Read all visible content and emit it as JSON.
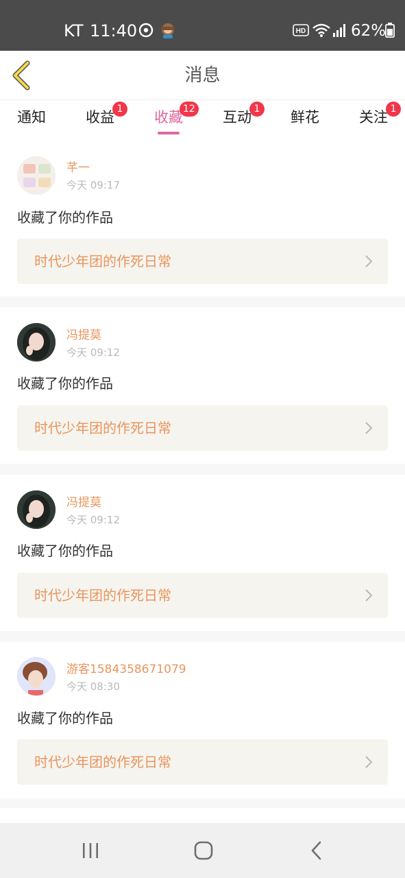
{
  "status_bar": {
    "carrier": "KT",
    "time": "11:40",
    "battery_percent": "62%",
    "icons": [
      "weibo-icon",
      "monkey-emoji-icon",
      "hd-icon",
      "wifi-icon",
      "signal-icon",
      "battery-icon"
    ]
  },
  "header": {
    "title": "消息",
    "back_icon": "chevron-left-icon"
  },
  "tabs": [
    {
      "label": "通知",
      "badge": ""
    },
    {
      "label": "收益",
      "badge": "1"
    },
    {
      "label": "收藏",
      "badge": "12",
      "active": true
    },
    {
      "label": "互动",
      "badge": "1"
    },
    {
      "label": "鲜花",
      "badge": ""
    },
    {
      "label": "关注",
      "badge": "1"
    }
  ],
  "messages": [
    {
      "user": "芊一",
      "time": "今天 09:17",
      "action": "收藏了你的作品",
      "work": "时代少年团的作死日常",
      "avatar": "avatar-illustration"
    },
    {
      "user": "冯提莫",
      "time": "今天 09:12",
      "action": "收藏了你的作品",
      "work": "时代少年团的作死日常",
      "avatar": "avatar-photo-girl"
    },
    {
      "user": "冯提莫",
      "time": "今天 09:12",
      "action": "收藏了你的作品",
      "work": "时代少年团的作死日常",
      "avatar": "avatar-photo-girl"
    },
    {
      "user": "游客1584358671079",
      "time": "今天 08:30",
      "action": "收藏了你的作品",
      "work": "时代少年团的作死日常",
      "avatar": "avatar-photo-boy"
    }
  ],
  "nav_bar": {
    "buttons": [
      "recent-apps-icon",
      "home-icon",
      "back-icon"
    ]
  },
  "colors": {
    "accent": "#e0669d",
    "username": "#e8955e",
    "badge": "#f2364a",
    "status_bar": "#4b4b4b"
  }
}
